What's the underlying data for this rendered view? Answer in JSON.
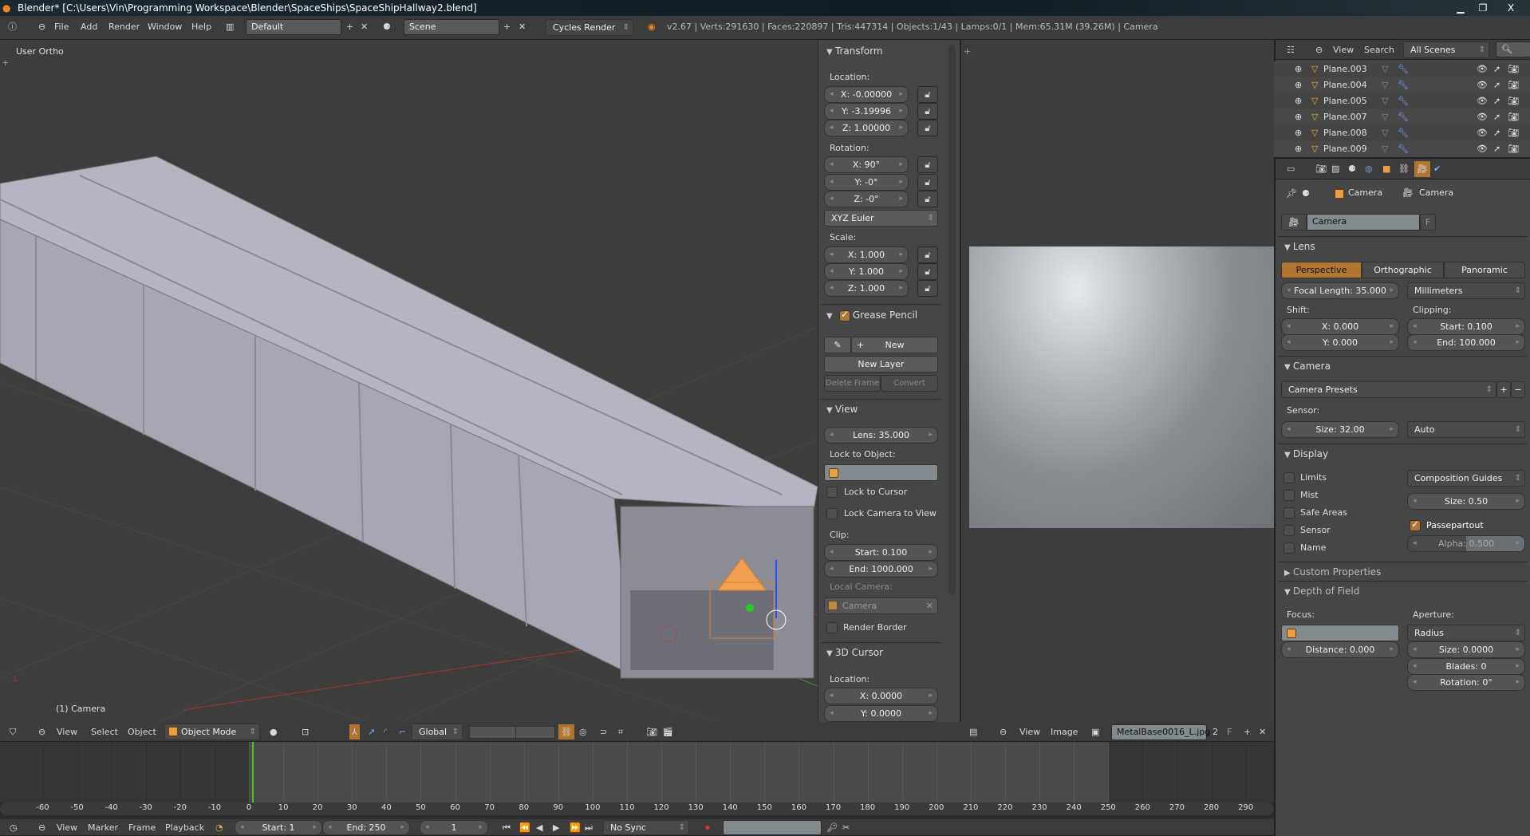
{
  "window": {
    "title": "Blender* [C:\\Users\\Vin\\Programming Workspace\\Blender\\SpaceShips\\SpaceShipHallway2.blend]",
    "min": "▁",
    "max": "❐",
    "close": "X"
  },
  "info_header": {
    "menus": [
      "File",
      "Add",
      "Render",
      "Window",
      "Help"
    ],
    "layout": "Default",
    "scene": "Scene",
    "engine": "Cycles Render",
    "stats": "v2.67 | Verts:291630 | Faces:220897 | Tris:447314 | Objects:1/43 | Lamps:0/1 | Mem:65.31M (39.26M) | Camera"
  },
  "viewport": {
    "view_label": "User Ortho",
    "object_label": "(1) Camera",
    "header": {
      "menus": [
        "View",
        "Select",
        "Object"
      ],
      "mode": "Object Mode",
      "orientation": "Global"
    }
  },
  "npanel": {
    "transform": {
      "title": "Transform",
      "location_label": "Location:",
      "loc": [
        "X: -0.00000",
        "Y: -3.19996",
        "Z: 1.00000"
      ],
      "rotation_label": "Rotation:",
      "rot": [
        "X: 90°",
        "Y: -0°",
        "Z: -0°"
      ],
      "rotation_mode": "XYZ Euler",
      "scale_label": "Scale:",
      "scale": [
        "X: 1.000",
        "Y: 1.000",
        "Z: 1.000"
      ]
    },
    "grease_pencil": {
      "title": "Grease Pencil",
      "enabled": true,
      "new": "New",
      "new_layer": "New Layer",
      "delete_frame": "Delete Frame",
      "convert": "Convert"
    },
    "view": {
      "title": "View",
      "lens": "Lens: 35.000",
      "lock_object_label": "Lock to Object:",
      "lock_cursor": "Lock to Cursor",
      "lock_camera": "Lock Camera to View",
      "clip_label": "Clip:",
      "clip_start": "Start: 0.100",
      "clip_end": "End: 1000.000",
      "local_camera_label": "Local Camera:",
      "local_camera": "Camera",
      "render_border": "Render Border"
    },
    "cursor": {
      "title": "3D Cursor",
      "location_label": "Location:",
      "x": "X: 0.0000",
      "y": "Y: 0.0000"
    }
  },
  "image_editor": {
    "menus": [
      "View",
      "Image"
    ],
    "image_name": "MetalBase0016_L.jpg",
    "users": "2",
    "fake": "F"
  },
  "outliner": {
    "menus": [
      "View",
      "Search"
    ],
    "filter": "All Scenes",
    "rows": [
      "Plane.003",
      "Plane.004",
      "Plane.005",
      "Plane.007",
      "Plane.008",
      "Plane.009"
    ]
  },
  "properties": {
    "breadcrumb": [
      "Camera",
      "Camera"
    ],
    "datablock": "Camera",
    "fake": "F",
    "lens": {
      "title": "Lens",
      "types": [
        "Perspective",
        "Orthographic",
        "Panoramic"
      ],
      "active": "Perspective",
      "focal": "Focal Length: 35.000",
      "units": "Millimeters",
      "shift_label": "Shift:",
      "shift_x": "X: 0.000",
      "shift_y": "Y: 0.000",
      "clip_label": "Clipping:",
      "clip_start": "Start: 0.100",
      "clip_end": "End: 100.000"
    },
    "camera": {
      "title": "Camera",
      "presets": "Camera Presets",
      "sensor_label": "Sensor:",
      "size": "Size: 32.00",
      "fit": "Auto"
    },
    "display": {
      "title": "Display",
      "checks": [
        "Limits",
        "Mist",
        "Safe Areas",
        "Sensor",
        "Name"
      ],
      "guides": "Composition Guides",
      "size": "Size: 0.50",
      "passepartout": "Passepartout",
      "alpha": "Alpha: 0.500",
      "alpha_value": 0.5
    },
    "custom": {
      "title": "Custom Properties"
    },
    "dof": {
      "title": "Depth of Field",
      "focus_label": "Focus:",
      "aperture_label": "Aperture:",
      "aperture_type": "Radius",
      "distance": "Distance: 0.000",
      "size": "Size: 0.0000",
      "blades": "Blades: 0",
      "rotation": "Rotation: 0°"
    }
  },
  "timeline": {
    "ticks": [
      -60,
      -50,
      -40,
      -30,
      -20,
      -10,
      0,
      10,
      20,
      30,
      40,
      50,
      60,
      70,
      80,
      90,
      100,
      110,
      120,
      130,
      140,
      150,
      160,
      170,
      180,
      190,
      200,
      210,
      220,
      230,
      240,
      250,
      260,
      270,
      280,
      290
    ],
    "current_frame": 1,
    "start": "Start: 1",
    "end": "End: 250",
    "frame": "1",
    "menus": [
      "View",
      "Marker",
      "Frame",
      "Playback"
    ],
    "sync": "No Sync",
    "playhead_color": "#4fc42a"
  },
  "colors": {
    "accent": "#b07530",
    "viewport": "#3d3d3d"
  }
}
